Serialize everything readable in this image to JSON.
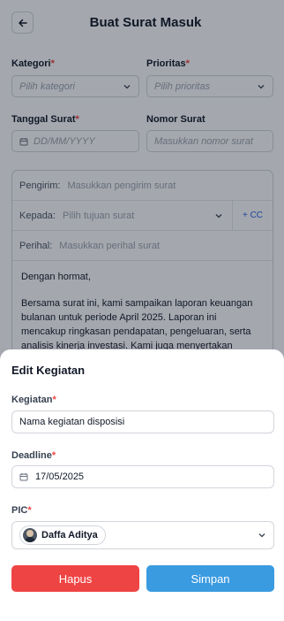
{
  "header": {
    "title": "Buat Surat Masuk"
  },
  "form": {
    "kategori": {
      "label": "Kategori",
      "required": "*",
      "placeholder": "Pilih kategori"
    },
    "prioritas": {
      "label": "Prioritas",
      "required": "*",
      "placeholder": "Pilih prioritas"
    },
    "tanggal": {
      "label": "Tanggal Surat",
      "required": "*",
      "placeholder": "DD/MM/YYYY"
    },
    "nomor": {
      "label": "Nomor Surat",
      "placeholder": "Masukkan nomor surat"
    }
  },
  "compose": {
    "pengirim": {
      "label": "Pengirim:",
      "placeholder": "Masukkan pengirim surat"
    },
    "kepada": {
      "label": "Kepada:",
      "placeholder": "Pilih tujuan surat",
      "cc": "+ CC"
    },
    "perihal": {
      "label": "Perihal:",
      "placeholder": "Masukkan perihal surat"
    },
    "body": {
      "greeting": "Dengan hormat,",
      "paragraph": "Bersama surat ini, kami sampaikan laporan keuangan bulanan untuk periode April 2025. Laporan ini mencakup ringkasan pendapatan, pengeluaran, serta analisis kinerja investasi. Kami juga menyertakan"
    }
  },
  "sheet": {
    "title": "Edit Kegiatan",
    "kegiatan": {
      "label": "Kegiatan",
      "required": "*",
      "value": "Nama kegiatan disposisi"
    },
    "deadline": {
      "label": "Deadline",
      "required": "*",
      "value": "17/05/2025"
    },
    "pic": {
      "label": "PIC",
      "required": "*",
      "person": "Daffa Aditya"
    },
    "delete_label": "Hapus",
    "save_label": "Simpan"
  },
  "colors": {
    "danger": "#ef4444",
    "primary": "#3b9be0",
    "link": "#2563eb"
  },
  "icons": [
    "arrow-left-icon",
    "chevron-down-icon",
    "calendar-icon",
    "avatar"
  ]
}
